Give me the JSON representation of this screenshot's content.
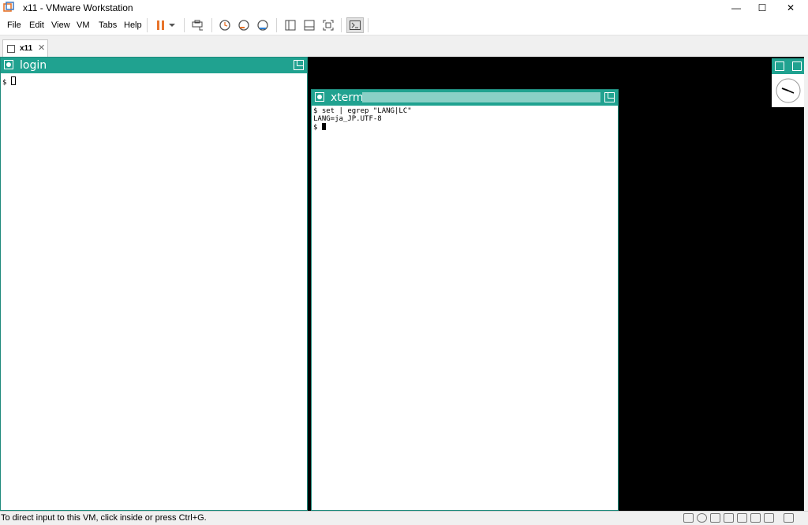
{
  "window": {
    "title": "x11 - VMware Workstation",
    "minimize_glyph": "—",
    "maximize_glyph": "☐",
    "close_glyph": "✕"
  },
  "menu": {
    "file": "File",
    "edit": "Edit",
    "view": "View",
    "vm": "VM",
    "tabs": "Tabs",
    "help": "Help"
  },
  "toolbar": {
    "icons": [
      "pause-icon",
      "dropdown-arrow-icon",
      "send-ctrl-alt-del-icon",
      "snapshot-icon",
      "revert-snapshot-icon",
      "manage-snapshots-icon",
      "sidebar-icon",
      "thumbnail-bar-icon",
      "fullscreen-icon",
      "console-view-icon"
    ],
    "accent_color": "#e8742b"
  },
  "tabs": [
    {
      "label": "x11",
      "close_glyph": "✕"
    }
  ],
  "guest": {
    "titlebar_color": "#20a290",
    "login_window": {
      "title": "login",
      "lines": [
        "$ "
      ]
    },
    "xterm_window": {
      "title": "xterm",
      "line1": "$ set | egrep \"LANG|LC\"",
      "line2": "LANG=ja_JP.UTF-8",
      "line3": "$ "
    }
  },
  "statusbar": {
    "message": "To direct input to this VM, click inside or press Ctrl+G."
  }
}
